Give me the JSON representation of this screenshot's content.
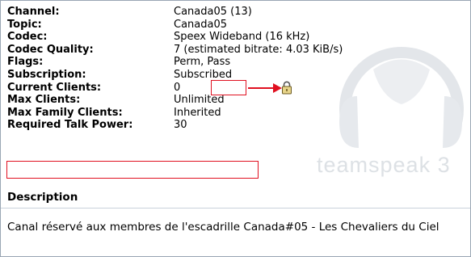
{
  "info_rows": [
    {
      "label": "Channel:",
      "value": "Canada05 (13)"
    },
    {
      "label": "Topic:",
      "value": "Canada05"
    },
    {
      "label": "Codec:",
      "value": "Speex Wideband (16 kHz)"
    },
    {
      "label": "Codec Quality:",
      "value": "7 (estimated bitrate: 4.03 KiB/s)"
    },
    {
      "label": "Flags:",
      "value_prefix": "Perm, ",
      "value_highlight": "Pass"
    },
    {
      "label": "Subscription:",
      "value": "Subscribed"
    },
    {
      "label": "Current Clients:",
      "value": "0"
    },
    {
      "label": "Max Clients:",
      "value": "Unlimited"
    },
    {
      "label": "Max Family Clients:",
      "value": "Inherited"
    },
    {
      "label": "Required Talk Power:",
      "value": "30"
    }
  ],
  "watermark_text": "teamspeak 3",
  "description": {
    "title": "Description",
    "text": "Canal réservé aux membres de l'escadrille Canada#05 - Les Chevaliers du Ciel"
  },
  "colors": {
    "annotation_red": "#e01020",
    "watermark_gray": "#d9dde2"
  },
  "icons": {
    "flags_lock": "lock-icon",
    "annotation_arrow": "arrow-right-icon"
  }
}
